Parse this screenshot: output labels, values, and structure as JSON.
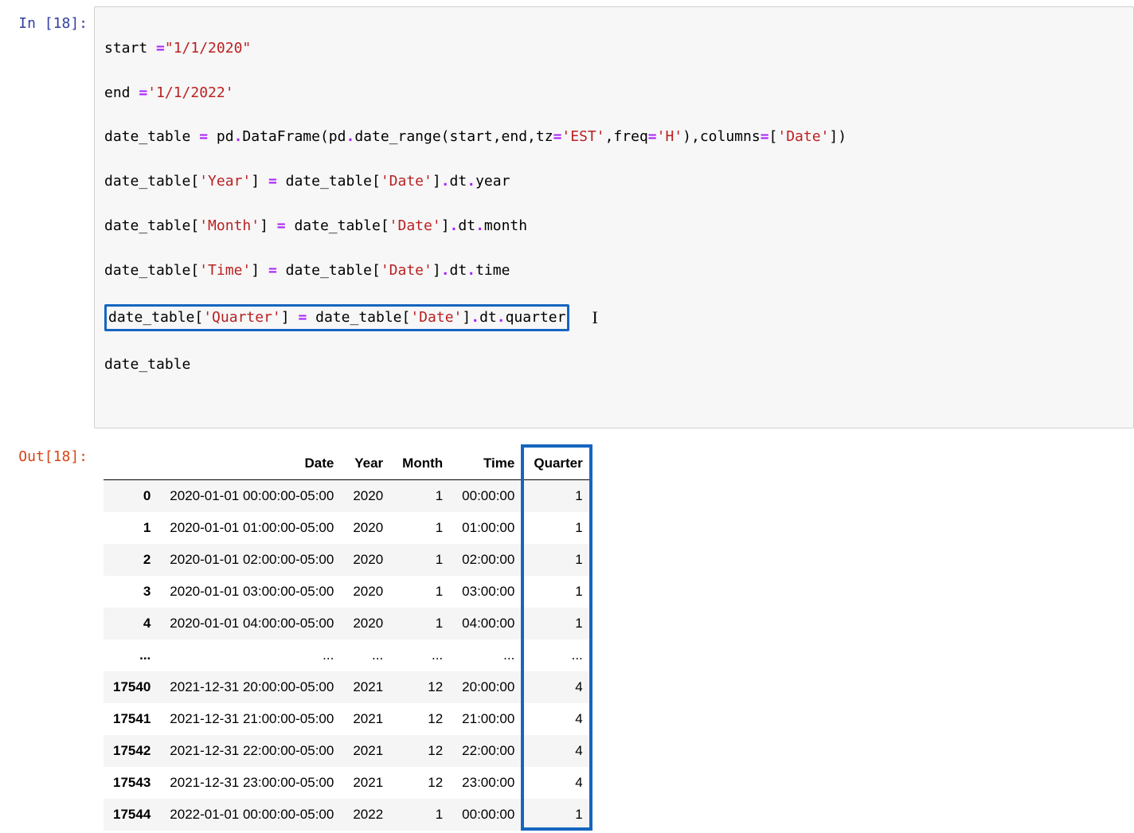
{
  "prompts": {
    "in_label": "In [18]:",
    "out_label": "Out[18]:"
  },
  "code": {
    "line1_a": "start ",
    "line1_op": "=",
    "line1_b": "\"1/1/2020\"",
    "line2_a": "end ",
    "line2_op": "=",
    "line2_b": "'1/1/2022'",
    "line3_a": "date_table ",
    "line3_op1": "=",
    "line3_b": " pd",
    "line3_op2": ".",
    "line3_c": "DataFrame(pd",
    "line3_op3": ".",
    "line3_d": "date_range(start,end,tz",
    "line3_op4": "=",
    "line3_e": "'EST'",
    "line3_f": ",freq",
    "line3_op5": "=",
    "line3_g": "'H'",
    "line3_h": "),columns",
    "line3_op6": "=",
    "line3_i": "[",
    "line3_j": "'Date'",
    "line3_k": "])",
    "line4_a": "date_table[",
    "line4_b": "'Year'",
    "line4_c": "] ",
    "line4_op": "=",
    "line4_d": " date_table[",
    "line4_e": "'Date'",
    "line4_f": "]",
    "line4_op2": ".",
    "line4_g": "dt",
    "line4_op3": ".",
    "line4_h": "year",
    "line5_a": "date_table[",
    "line5_b": "'Month'",
    "line5_c": "] ",
    "line5_op": "=",
    "line5_d": " date_table[",
    "line5_e": "'Date'",
    "line5_f": "]",
    "line5_op2": ".",
    "line5_g": "dt",
    "line5_op3": ".",
    "line5_h": "month",
    "line6_a": "date_table[",
    "line6_b": "'Time'",
    "line6_c": "] ",
    "line6_op": "=",
    "line6_d": " date_table[",
    "line6_e": "'Date'",
    "line6_f": "]",
    "line6_op2": ".",
    "line6_g": "dt",
    "line6_op3": ".",
    "line6_h": "time",
    "line7_a": "date_table[",
    "line7_b": "'Quarter'",
    "line7_c": "] ",
    "line7_op": "=",
    "line7_d": " date_table[",
    "line7_e": "'Date'",
    "line7_f": "]",
    "line7_op2": ".",
    "line7_g": "dt",
    "line7_op3": ".",
    "line7_h": "quarter",
    "line8": "date_table"
  },
  "table": {
    "columns": [
      "",
      "Date",
      "Year",
      "Month",
      "Time",
      "Quarter"
    ],
    "rows": [
      {
        "idx": "0",
        "date": "2020-01-01 00:00:00-05:00",
        "year": "2020",
        "month": "1",
        "time": "00:00:00",
        "quarter": "1"
      },
      {
        "idx": "1",
        "date": "2020-01-01 01:00:00-05:00",
        "year": "2020",
        "month": "1",
        "time": "01:00:00",
        "quarter": "1"
      },
      {
        "idx": "2",
        "date": "2020-01-01 02:00:00-05:00",
        "year": "2020",
        "month": "1",
        "time": "02:00:00",
        "quarter": "1"
      },
      {
        "idx": "3",
        "date": "2020-01-01 03:00:00-05:00",
        "year": "2020",
        "month": "1",
        "time": "03:00:00",
        "quarter": "1"
      },
      {
        "idx": "4",
        "date": "2020-01-01 04:00:00-05:00",
        "year": "2020",
        "month": "1",
        "time": "04:00:00",
        "quarter": "1"
      },
      {
        "idx": "...",
        "date": "...",
        "year": "...",
        "month": "...",
        "time": "...",
        "quarter": "..."
      },
      {
        "idx": "17540",
        "date": "2021-12-31 20:00:00-05:00",
        "year": "2021",
        "month": "12",
        "time": "20:00:00",
        "quarter": "4"
      },
      {
        "idx": "17541",
        "date": "2021-12-31 21:00:00-05:00",
        "year": "2021",
        "month": "12",
        "time": "21:00:00",
        "quarter": "4"
      },
      {
        "idx": "17542",
        "date": "2021-12-31 22:00:00-05:00",
        "year": "2021",
        "month": "12",
        "time": "22:00:00",
        "quarter": "4"
      },
      {
        "idx": "17543",
        "date": "2021-12-31 23:00:00-05:00",
        "year": "2021",
        "month": "12",
        "time": "23:00:00",
        "quarter": "4"
      },
      {
        "idx": "17544",
        "date": "2022-01-01 00:00:00-05:00",
        "year": "2022",
        "month": "1",
        "time": "00:00:00",
        "quarter": "1"
      }
    ]
  }
}
